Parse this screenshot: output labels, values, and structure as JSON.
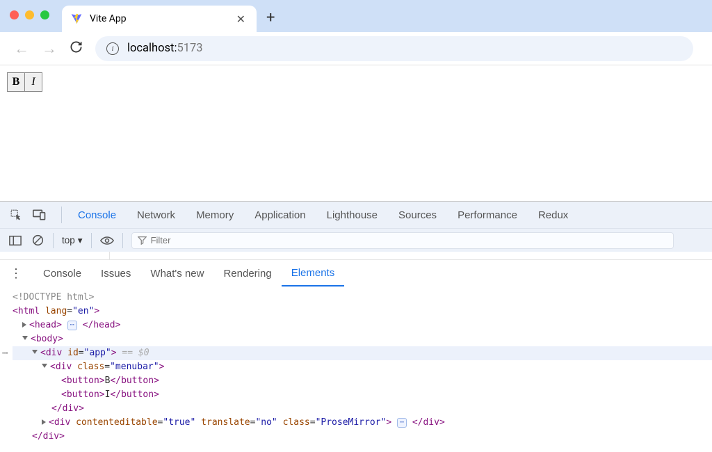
{
  "browser": {
    "tab_title": "Vite App",
    "url_host": "localhost:",
    "url_port": "5173"
  },
  "page": {
    "btn_bold": "B",
    "btn_italic": "I"
  },
  "devtools": {
    "top_tabs": [
      "Console",
      "Network",
      "Memory",
      "Application",
      "Lighthouse",
      "Sources",
      "Performance",
      "Redux"
    ],
    "active_top_tab": "Console",
    "context": "top",
    "filter_placeholder": "Filter",
    "drawer_tabs": [
      "Console",
      "Issues",
      "What's new",
      "Rendering",
      "Elements"
    ],
    "active_drawer_tab": "Elements"
  },
  "tree": {
    "doctype": "<!DOCTYPE html>",
    "html_open": "<html lang=\"en\">",
    "head_open": "<head>",
    "head_close": "</head>",
    "body_open": "<body>",
    "app_open_pre": "<div id=\"app\">",
    "selection_marker": " == $0",
    "menubar_open": "<div class=\"menubar\">",
    "btn_b": "<button>B</button>",
    "btn_i": "<button>I</button>",
    "div_close": "</div>",
    "prosemirror": "<div contenteditable=\"true\" translate=\"no\" class=\"ProseMirror\">",
    "div_close2": "</div>"
  }
}
